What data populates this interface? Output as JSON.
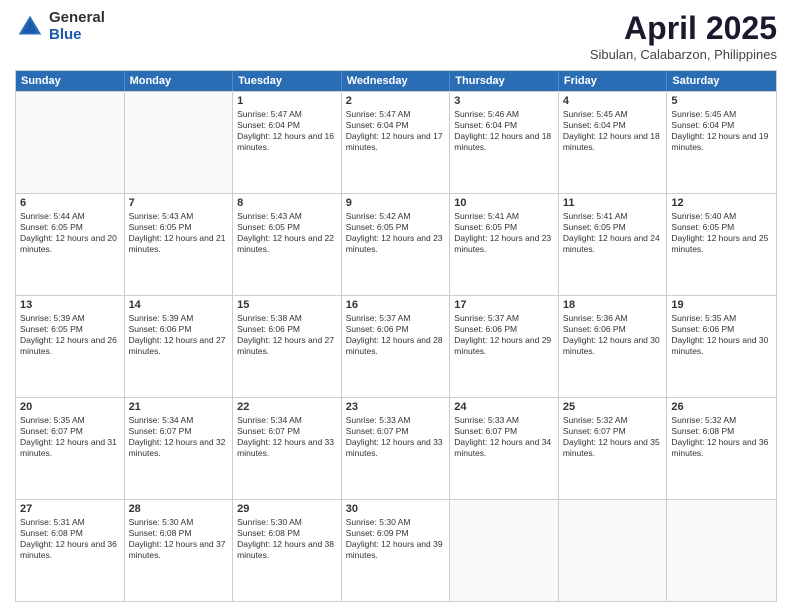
{
  "header": {
    "logo_general": "General",
    "logo_blue": "Blue",
    "title": "April 2025",
    "location": "Sibulan, Calabarzon, Philippines"
  },
  "days_of_week": [
    "Sunday",
    "Monday",
    "Tuesday",
    "Wednesday",
    "Thursday",
    "Friday",
    "Saturday"
  ],
  "weeks": [
    [
      {
        "day": "",
        "info": ""
      },
      {
        "day": "",
        "info": ""
      },
      {
        "day": "1",
        "info": "Sunrise: 5:47 AM\nSunset: 6:04 PM\nDaylight: 12 hours and 16 minutes."
      },
      {
        "day": "2",
        "info": "Sunrise: 5:47 AM\nSunset: 6:04 PM\nDaylight: 12 hours and 17 minutes."
      },
      {
        "day": "3",
        "info": "Sunrise: 5:46 AM\nSunset: 6:04 PM\nDaylight: 12 hours and 18 minutes."
      },
      {
        "day": "4",
        "info": "Sunrise: 5:45 AM\nSunset: 6:04 PM\nDaylight: 12 hours and 18 minutes."
      },
      {
        "day": "5",
        "info": "Sunrise: 5:45 AM\nSunset: 6:04 PM\nDaylight: 12 hours and 19 minutes."
      }
    ],
    [
      {
        "day": "6",
        "info": "Sunrise: 5:44 AM\nSunset: 6:05 PM\nDaylight: 12 hours and 20 minutes."
      },
      {
        "day": "7",
        "info": "Sunrise: 5:43 AM\nSunset: 6:05 PM\nDaylight: 12 hours and 21 minutes."
      },
      {
        "day": "8",
        "info": "Sunrise: 5:43 AM\nSunset: 6:05 PM\nDaylight: 12 hours and 22 minutes."
      },
      {
        "day": "9",
        "info": "Sunrise: 5:42 AM\nSunset: 6:05 PM\nDaylight: 12 hours and 23 minutes."
      },
      {
        "day": "10",
        "info": "Sunrise: 5:41 AM\nSunset: 6:05 PM\nDaylight: 12 hours and 23 minutes."
      },
      {
        "day": "11",
        "info": "Sunrise: 5:41 AM\nSunset: 6:05 PM\nDaylight: 12 hours and 24 minutes."
      },
      {
        "day": "12",
        "info": "Sunrise: 5:40 AM\nSunset: 6:05 PM\nDaylight: 12 hours and 25 minutes."
      }
    ],
    [
      {
        "day": "13",
        "info": "Sunrise: 5:39 AM\nSunset: 6:05 PM\nDaylight: 12 hours and 26 minutes."
      },
      {
        "day": "14",
        "info": "Sunrise: 5:39 AM\nSunset: 6:06 PM\nDaylight: 12 hours and 27 minutes."
      },
      {
        "day": "15",
        "info": "Sunrise: 5:38 AM\nSunset: 6:06 PM\nDaylight: 12 hours and 27 minutes."
      },
      {
        "day": "16",
        "info": "Sunrise: 5:37 AM\nSunset: 6:06 PM\nDaylight: 12 hours and 28 minutes."
      },
      {
        "day": "17",
        "info": "Sunrise: 5:37 AM\nSunset: 6:06 PM\nDaylight: 12 hours and 29 minutes."
      },
      {
        "day": "18",
        "info": "Sunrise: 5:36 AM\nSunset: 6:06 PM\nDaylight: 12 hours and 30 minutes."
      },
      {
        "day": "19",
        "info": "Sunrise: 5:35 AM\nSunset: 6:06 PM\nDaylight: 12 hours and 30 minutes."
      }
    ],
    [
      {
        "day": "20",
        "info": "Sunrise: 5:35 AM\nSunset: 6:07 PM\nDaylight: 12 hours and 31 minutes."
      },
      {
        "day": "21",
        "info": "Sunrise: 5:34 AM\nSunset: 6:07 PM\nDaylight: 12 hours and 32 minutes."
      },
      {
        "day": "22",
        "info": "Sunrise: 5:34 AM\nSunset: 6:07 PM\nDaylight: 12 hours and 33 minutes."
      },
      {
        "day": "23",
        "info": "Sunrise: 5:33 AM\nSunset: 6:07 PM\nDaylight: 12 hours and 33 minutes."
      },
      {
        "day": "24",
        "info": "Sunrise: 5:33 AM\nSunset: 6:07 PM\nDaylight: 12 hours and 34 minutes."
      },
      {
        "day": "25",
        "info": "Sunrise: 5:32 AM\nSunset: 6:07 PM\nDaylight: 12 hours and 35 minutes."
      },
      {
        "day": "26",
        "info": "Sunrise: 5:32 AM\nSunset: 6:08 PM\nDaylight: 12 hours and 36 minutes."
      }
    ],
    [
      {
        "day": "27",
        "info": "Sunrise: 5:31 AM\nSunset: 6:08 PM\nDaylight: 12 hours and 36 minutes."
      },
      {
        "day": "28",
        "info": "Sunrise: 5:30 AM\nSunset: 6:08 PM\nDaylight: 12 hours and 37 minutes."
      },
      {
        "day": "29",
        "info": "Sunrise: 5:30 AM\nSunset: 6:08 PM\nDaylight: 12 hours and 38 minutes."
      },
      {
        "day": "30",
        "info": "Sunrise: 5:30 AM\nSunset: 6:09 PM\nDaylight: 12 hours and 39 minutes."
      },
      {
        "day": "",
        "info": ""
      },
      {
        "day": "",
        "info": ""
      },
      {
        "day": "",
        "info": ""
      }
    ]
  ]
}
